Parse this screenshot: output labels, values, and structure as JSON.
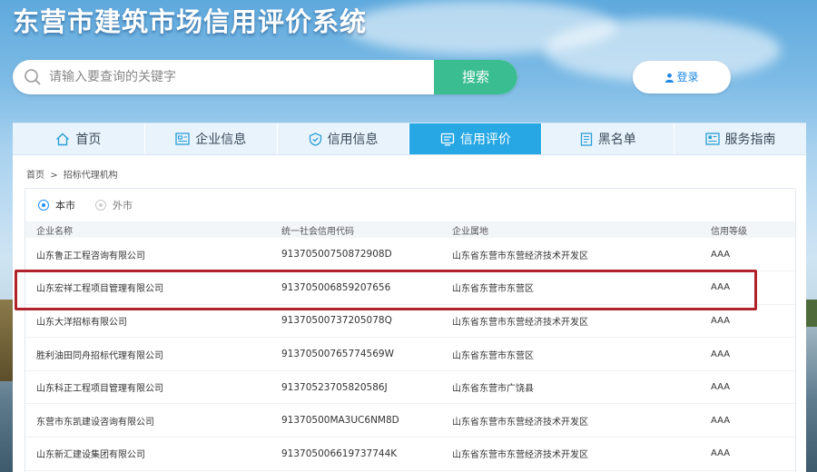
{
  "header": {
    "site_title": "东营市建筑市场信用评价系统"
  },
  "search": {
    "placeholder": "请输入要查询的关键字",
    "button_label": "搜索"
  },
  "login": {
    "label": "登录"
  },
  "nav": {
    "items": [
      {
        "label": "首页",
        "icon": "home-icon"
      },
      {
        "label": "企业信息",
        "icon": "company-icon"
      },
      {
        "label": "信用信息",
        "icon": "shield-icon"
      },
      {
        "label": "信用评价",
        "icon": "evaluation-icon",
        "active": true
      },
      {
        "label": "黑名单",
        "icon": "blacklist-icon"
      },
      {
        "label": "服务指南",
        "icon": "guide-icon"
      }
    ]
  },
  "breadcrumb": {
    "home": "首页",
    "separator": ">",
    "current": "招标代理机构"
  },
  "filter": {
    "options": [
      {
        "label": "本市",
        "selected": true
      },
      {
        "label": "外市",
        "selected": false
      }
    ]
  },
  "table": {
    "headers": [
      "企业名称",
      "统一社会信用代码",
      "企业属地",
      "信用等级"
    ],
    "rows": [
      [
        "山东鲁正工程咨询有限公司",
        "91370500750872908D",
        "山东省东营市东营经济技术开发区",
        "AAA"
      ],
      [
        "山东宏祥工程项目管理有限公司",
        "913705006859207656",
        "山东省东营市东营区",
        "AAA"
      ],
      [
        "山东大洋招标有限公司",
        "91370500737205078Q",
        "山东省东营市东营经济技术开发区",
        "AAA"
      ],
      [
        "胜利油田同舟招标代理有限公司",
        "91370500765774569W",
        "山东省东营市东营区",
        "AAA"
      ],
      [
        "山东科正工程项目管理有限公司",
        "91370523705820586J",
        "山东省东营市广饶县",
        "AAA"
      ],
      [
        "东营市东凯建设咨询有限公司",
        "91370500MA3UC6NM8D",
        "山东省东营市东营经济技术开发区",
        "AAA"
      ],
      [
        "山东新汇建设集团有限公司",
        "913705006619737744K",
        "山东省东营市东营经济技术开发区",
        "AAA"
      ]
    ]
  },
  "colors": {
    "accent": "#27a8e5",
    "search_button": "#3bbd92",
    "highlight": "#b0232a"
  }
}
